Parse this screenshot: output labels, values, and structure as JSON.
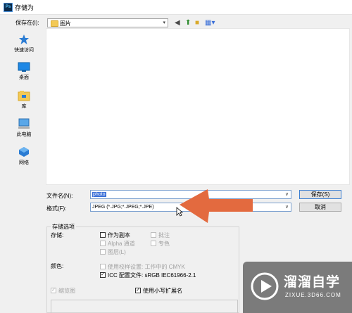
{
  "window": {
    "title": "存储为",
    "app_icon": "Ps"
  },
  "header": {
    "save_in_label": "保存在(I):",
    "folder": "图片"
  },
  "places": [
    {
      "label": "快速访问",
      "icon": "star-icon"
    },
    {
      "label": "桌面",
      "icon": "desktop-icon"
    },
    {
      "label": "库",
      "icon": "library-icon"
    },
    {
      "label": "此电脑",
      "icon": "computer-icon"
    },
    {
      "label": "网络",
      "icon": "network-icon"
    }
  ],
  "form": {
    "filename_label": "文件名(N):",
    "filename_value": "photo",
    "format_label": "格式(F):",
    "format_value": "JPEG (*.JPG;*.JPEG;*.JPE)",
    "save_button": "保存(S)",
    "cancel_button": "取消"
  },
  "options": {
    "group_label": "存储选项",
    "store_label": "存储:",
    "as_copy": "作为副本",
    "notes": "批注",
    "alpha": "Alpha 通道",
    "spot": "专色",
    "layers": "图层(L)",
    "color_label": "颜色:",
    "proof": "使用校样设置: 工作中的 CMYK",
    "icc": "ICC 配置文件: sRGB IEC61966-2.1",
    "thumbnail": "缩览图",
    "lowercase_ext": "使用小写扩展名"
  },
  "watermark": {
    "brand": "溜溜自学",
    "url": "ZIXUE.3D66.COM"
  },
  "colors": {
    "accent": "#3a6fd8",
    "arrow": "#e36a3f"
  }
}
